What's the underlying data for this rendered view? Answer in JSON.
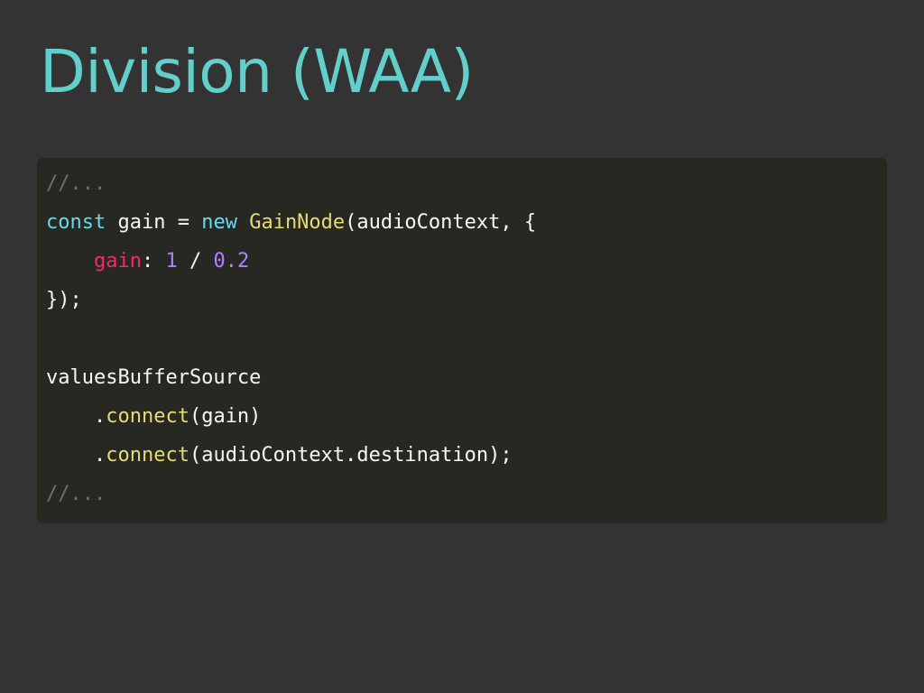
{
  "slide": {
    "title": "Division (WAA)"
  },
  "code": {
    "line1": {
      "comment": "//..."
    },
    "line2": {
      "kw_const": "const",
      "var": " gain = ",
      "kw_new": "new",
      "sp": " ",
      "class_name": "GainNode",
      "args": "(audioContext, {"
    },
    "line3": {
      "indent": "    ",
      "prop": "gain",
      "colon": ": ",
      "num1": "1",
      "op": " / ",
      "num2": "0.2"
    },
    "line4": {
      "text": "});"
    },
    "line5": {
      "text": ""
    },
    "line6": {
      "text": "valuesBufferSource"
    },
    "line7": {
      "indent": "    .",
      "method": "connect",
      "args": "(gain)"
    },
    "line8": {
      "indent": "    .",
      "method": "connect",
      "args": "(audioContext.destination);"
    },
    "line9": {
      "comment": "//..."
    }
  },
  "colors": {
    "background": "#333333",
    "title": "#63cfca",
    "code_background": "#272822",
    "comment": "#75715e",
    "keyword": "#66d9ef",
    "function": "#e6db74",
    "property": "#f92672",
    "number": "#ae81ff",
    "text": "#f8f8f2"
  }
}
